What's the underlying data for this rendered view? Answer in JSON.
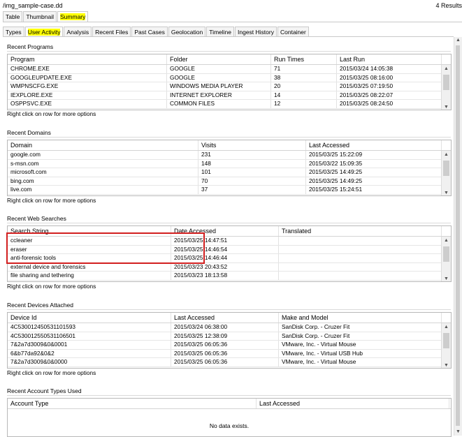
{
  "header": {
    "path": "/img_sample-case.dd",
    "result_count": "4 Results"
  },
  "top_tabs": [
    {
      "label": "Table",
      "active": false,
      "highlighted": false
    },
    {
      "label": "Thumbnail",
      "active": false,
      "highlighted": false
    },
    {
      "label": "Summary",
      "active": true,
      "highlighted": true
    }
  ],
  "sub_tabs": [
    {
      "label": "Types",
      "active": false,
      "highlighted": false
    },
    {
      "label": "User Activity",
      "active": true,
      "highlighted": true
    },
    {
      "label": "Analysis",
      "active": false,
      "highlighted": false
    },
    {
      "label": "Recent Files",
      "active": false,
      "highlighted": false
    },
    {
      "label": "Past Cases",
      "active": false,
      "highlighted": false
    },
    {
      "label": "Geolocation",
      "active": false,
      "highlighted": false
    },
    {
      "label": "Timeline",
      "active": false,
      "highlighted": false
    },
    {
      "label": "Ingest History",
      "active": false,
      "highlighted": false
    },
    {
      "label": "Container",
      "active": false,
      "highlighted": false
    }
  ],
  "hint_text": "Right click on row for more options",
  "sections": {
    "recent_programs": {
      "title": "Recent Programs",
      "columns": [
        "Program",
        "Folder",
        "Run Times",
        "Last Run"
      ],
      "rows": [
        [
          "CHROME.EXE",
          "GOOGLE",
          "71",
          "2015/03/24 14:05:38"
        ],
        [
          "GOOGLEUPDATE.EXE",
          "GOOGLE",
          "38",
          "2015/03/25 08:16:00"
        ],
        [
          "WMPNSCFG.EXE",
          "WINDOWS MEDIA PLAYER",
          "20",
          "2015/03/25 07:19:50"
        ],
        [
          "IEXPLORE.EXE",
          "INTERNET EXPLORER",
          "14",
          "2015/03/25 08:22:07"
        ],
        [
          "OSPPSVC.EXE",
          "COMMON FILES",
          "12",
          "2015/03/25 08:24:50"
        ]
      ]
    },
    "recent_domains": {
      "title": "Recent Domains",
      "columns": [
        "Domain",
        "Visits",
        "Last Accessed"
      ],
      "rows": [
        [
          "google.com",
          "231",
          "2015/03/25 15:22:09"
        ],
        [
          "s-msn.com",
          "148",
          "2015/03/22 15:09:35"
        ],
        [
          "microsoft.com",
          "101",
          "2015/03/25 14:49:25"
        ],
        [
          "bing.com",
          "70",
          "2015/03/25 14:49:25"
        ],
        [
          "live.com",
          "37",
          "2015/03/25 15:24:51"
        ]
      ]
    },
    "recent_web_searches": {
      "title": "Recent Web Searches",
      "columns": [
        "Search String",
        "Date Accessed",
        "Translated"
      ],
      "rows": [
        [
          "ccleaner",
          "2015/03/25 14:47:51",
          ""
        ],
        [
          "eraser",
          "2015/03/25 14:46:54",
          ""
        ],
        [
          "anti-forensic tools",
          "2015/03/25 14:46:44",
          ""
        ],
        [
          "external device and forensics",
          "2015/03/23 20:43:52",
          ""
        ],
        [
          "file sharing and tethering",
          "2015/03/23 18:13:58",
          ""
        ]
      ]
    },
    "recent_devices": {
      "title": "Recent Devices Attached",
      "columns": [
        "Device Id",
        "Last Accessed",
        "Make and Model"
      ],
      "rows": [
        [
          "4C530012450531101593",
          "2015/03/24 06:38:00",
          "SanDisk Corp. - Cruzer Fit"
        ],
        [
          "4C530012550531106501",
          "2015/03/25 12:38:09",
          "SanDisk Corp. - Cruzer Fit"
        ],
        [
          "7&2a7d3009&0&0001",
          "2015/03/25 06:05:36",
          "VMware, Inc. - Virtual Mouse"
        ],
        [
          "6&b77da92&0&2",
          "2015/03/25 06:05:36",
          "VMware, Inc. - Virtual USB Hub"
        ],
        [
          "7&2a7d3009&0&0000",
          "2015/03/25 06:05:36",
          "VMware, Inc. - Virtual Mouse"
        ]
      ]
    },
    "recent_account_types": {
      "title": "Recent Account Types Used",
      "columns": [
        "Account Type",
        "Last Accessed"
      ],
      "empty_text": "No data exists."
    }
  },
  "icons": {
    "scroll_up": "chevron-up-icon",
    "scroll_down": "chevron-down-icon"
  },
  "colors": {
    "tab_highlight": "#ffff00",
    "annotation_box": "#d21f1f"
  }
}
